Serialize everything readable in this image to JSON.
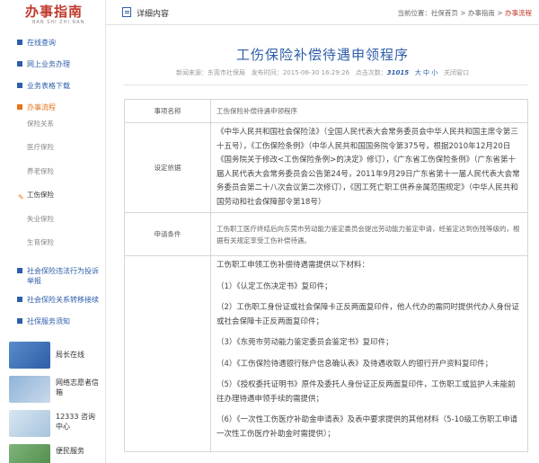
{
  "brand": {
    "title": "办事指南",
    "pinyin": "BAN SHI ZHI NAN"
  },
  "nav": [
    {
      "label": "在线查询"
    },
    {
      "label": "网上业务办理"
    },
    {
      "label": "业务表格下载"
    },
    {
      "label": "办事流程"
    }
  ],
  "subnav": [
    "保险关系",
    "医疗保险",
    "养老保险",
    "工伤保险",
    "失业保险",
    "生育保险"
  ],
  "nav2": [
    {
      "label": "社会保险违法行为投诉举报"
    },
    {
      "label": "社会保险关系转移接续"
    },
    {
      "label": "社保服务须知"
    }
  ],
  "services": [
    {
      "label": "局长在线"
    },
    {
      "label": "网络志愿者信箱"
    },
    {
      "label": "12333 咨询中心"
    },
    {
      "label": "便民服务"
    }
  ],
  "header": {
    "title": "详细内容",
    "breadcrumb": "当前位置：社保首页 > 办事指南 >",
    "breadcrumb_current": "办事流程"
  },
  "article": {
    "title": "工伤保险补偿待遇申领程序",
    "source": "新闻来源：东莞市社保局",
    "date": "发布时间：2015-06-30 16:29:26",
    "views_label": "点击次数：",
    "views": "31015",
    "font_size": "大 中 小",
    "close": "关闭窗口"
  },
  "table": {
    "rows": [
      {
        "key": "事项名称",
        "value": "工伤保险补偿待遇申领程序"
      },
      {
        "key": "设定依据",
        "value": "《中华人民共和国社会保险法》（全国人民代表大会常务委员会中华人民共和国主席令第三十五号），《工伤保险条例》（中华人民共和国国务院令第375号，根据2010年12月20日《国务院关于修改<工伤保险条例>的决定》修订），《广东省工伤保险条例》（广东省第十届人民代表大会常务委员会公告第24号，2011年9月29日广东省第十一届人民代表大会常务委员会第二十八次会议第二次修订），《因工死亡职工供养亲属范围规定》（中华人民共和国劳动和社会保障部令第18号）"
      },
      {
        "key": "申请条件",
        "value": "工伤职工医疗终结后向东莞市劳动能力鉴定委员会提出劳动能力鉴定申请，经鉴定达到伤残等级的，根据有关规定享受工伤补偿待遇。"
      }
    ],
    "materials": [
      "工伤职工申领工伤补偿待遇需提供以下材料：",
      "（1）《认定工伤决定书》复印件；",
      "（2）工伤职工身份证或社会保障卡正反两面复印件，他人代办的需同时提供代办人身份证或社会保障卡正反两面复印件；",
      "（3）《东莞市劳动能力鉴定委员会鉴定书》复印件；",
      "（4）《工伤保险待遇银行账户信息确认表》及待遇收取人的银行开户资料复印件；",
      "（5）《授权委托证明书》原件及委托人身份证正反两面复印件，工伤职工或监护人未能前往办理待遇申领手续的需提供；",
      "（6）《一次性工伤医疗补助金申请表》及表中要求提供的其他材料（5-10级工伤职工申请一次性工伤医疗补助金时需提供）；"
    ]
  },
  "colors": {
    "accent": "#2d5ea8",
    "active": "#e8731b",
    "brand": "#c0392b"
  }
}
